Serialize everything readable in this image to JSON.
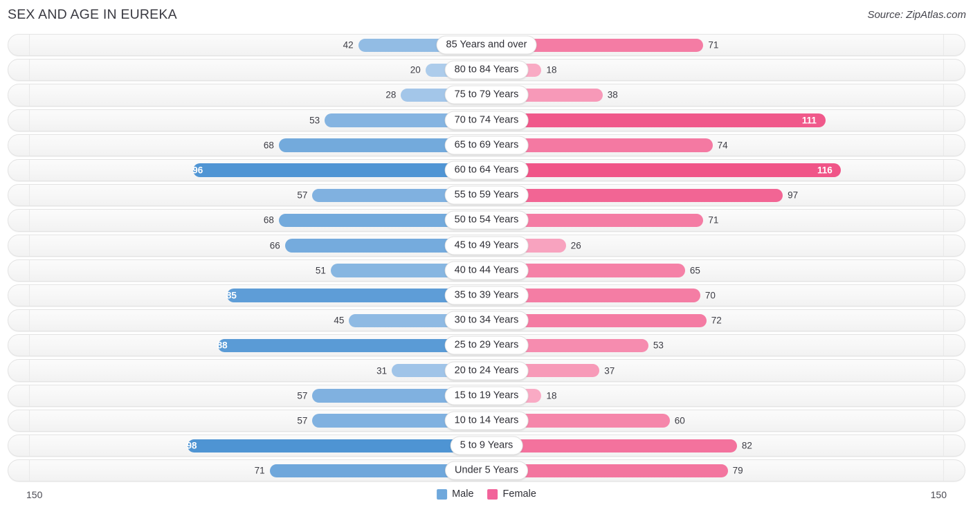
{
  "header": {
    "title": "SEX AND AGE IN EUREKA",
    "source": "Source: ZipAtlas.com"
  },
  "footer": {
    "axis_left": "150",
    "axis_right": "150",
    "legend": [
      {
        "label": "Male",
        "color": "#6fa8dc"
      },
      {
        "label": "Female",
        "color": "#f2639a"
      }
    ]
  },
  "chart_data": {
    "type": "bar",
    "title": "SEX AND AGE IN EUREKA",
    "subtitle": "Source: ZipAtlas.com",
    "orientation": "horizontal-diverging",
    "xlabel": "",
    "ylabel": "",
    "xlim": [
      150,
      150
    ],
    "axis_max": 150,
    "grid": true,
    "legend_position": "bottom-center",
    "categories": [
      "85 Years and over",
      "80 to 84 Years",
      "75 to 79 Years",
      "70 to 74 Years",
      "65 to 69 Years",
      "60 to 64 Years",
      "55 to 59 Years",
      "50 to 54 Years",
      "45 to 49 Years",
      "40 to 44 Years",
      "35 to 39 Years",
      "30 to 34 Years",
      "25 to 29 Years",
      "20 to 24 Years",
      "15 to 19 Years",
      "10 to 14 Years",
      "5 to 9 Years",
      "Under 5 Years"
    ],
    "series": [
      {
        "name": "Male",
        "color": "#6fa8dc",
        "values": [
          42,
          20,
          28,
          53,
          68,
          96,
          57,
          68,
          66,
          51,
          85,
          45,
          88,
          31,
          57,
          57,
          98,
          71
        ]
      },
      {
        "name": "Female",
        "color": "#f2639a",
        "values": [
          71,
          18,
          38,
          111,
          74,
          116,
          97,
          71,
          26,
          65,
          70,
          72,
          53,
          37,
          18,
          60,
          82,
          79
        ]
      }
    ]
  },
  "rows": [
    {
      "age": "85 Years and over",
      "male": 42,
      "female": 71
    },
    {
      "age": "80 to 84 Years",
      "male": 20,
      "female": 18
    },
    {
      "age": "75 to 79 Years",
      "male": 28,
      "female": 38
    },
    {
      "age": "70 to 74 Years",
      "male": 53,
      "female": 111
    },
    {
      "age": "65 to 69 Years",
      "male": 68,
      "female": 74
    },
    {
      "age": "60 to 64 Years",
      "male": 96,
      "female": 116
    },
    {
      "age": "55 to 59 Years",
      "male": 57,
      "female": 97
    },
    {
      "age": "50 to 54 Years",
      "male": 68,
      "female": 71
    },
    {
      "age": "45 to 49 Years",
      "male": 66,
      "female": 26
    },
    {
      "age": "40 to 44 Years",
      "male": 51,
      "female": 65
    },
    {
      "age": "35 to 39 Years",
      "male": 85,
      "female": 70
    },
    {
      "age": "30 to 34 Years",
      "male": 45,
      "female": 72
    },
    {
      "age": "25 to 29 Years",
      "male": 88,
      "female": 53
    },
    {
      "age": "20 to 24 Years",
      "male": 31,
      "female": 37
    },
    {
      "age": "15 to 19 Years",
      "male": 57,
      "female": 18
    },
    {
      "age": "10 to 14 Years",
      "male": 57,
      "female": 60
    },
    {
      "age": "5 to 9 Years",
      "male": 98,
      "female": 82
    },
    {
      "age": "Under 5 Years",
      "male": 71,
      "female": 79
    }
  ]
}
